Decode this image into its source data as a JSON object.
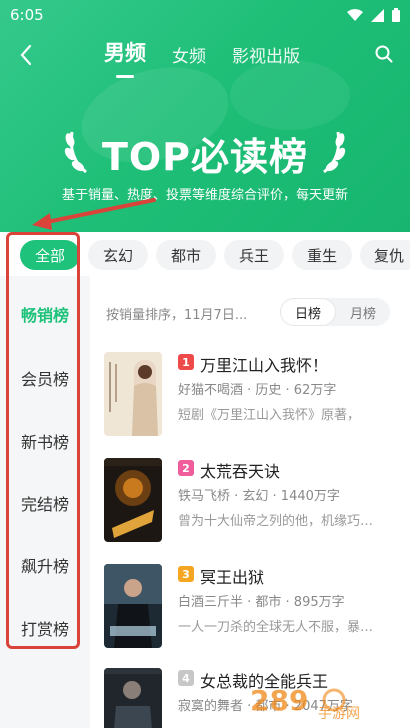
{
  "status": {
    "time": "6:05"
  },
  "nav": {
    "tabs": [
      "男频",
      "女频",
      "影视出版"
    ],
    "active_tab": 0
  },
  "banner": {
    "title": "TOP必读榜",
    "subtitle": "基于销量、热度、投票等维度综合评价，每天更新"
  },
  "chips": [
    "全部",
    "玄幻",
    "都市",
    "兵王",
    "重生",
    "复仇"
  ],
  "side_items": [
    "畅销榜",
    "会员榜",
    "新书榜",
    "完结榜",
    "飙升榜",
    "打赏榜"
  ],
  "sort": {
    "text": "按销量排序，11月7日...",
    "options": [
      "日榜",
      "月榜"
    ]
  },
  "books": [
    {
      "rank": "1",
      "title": "万里江山入我怀！",
      "meta": "好猫不喝酒 · 历史 · 62万字",
      "desc": "短剧《万里江山入我怀》原著，",
      "rank_color": "#ef4a4a"
    },
    {
      "rank": "2",
      "title": "太荒吞天诀",
      "meta": "铁马飞桥 · 玄幻 · 1440万字",
      "desc": "曾为十大仙帝之列的他，机缘巧…",
      "rank_color": "#f05c9c"
    },
    {
      "rank": "3",
      "title": "冥王出狱",
      "meta": "白酒三斤半 · 都市 · 895万字",
      "desc": "一人一刀杀的全球无人不服，暴…",
      "rank_color": "#f5a623"
    },
    {
      "rank": "4",
      "title": "女总裁的全能兵王",
      "meta": "寂寞的舞者 · 都市 · 2047万字",
      "desc": "",
      "rank_color": "#c7c7c7"
    }
  ],
  "colors": {
    "accent": "#1ec27a",
    "header": "#1fbf78",
    "annotation": "#d9433a"
  },
  "watermark": "289 手游网"
}
